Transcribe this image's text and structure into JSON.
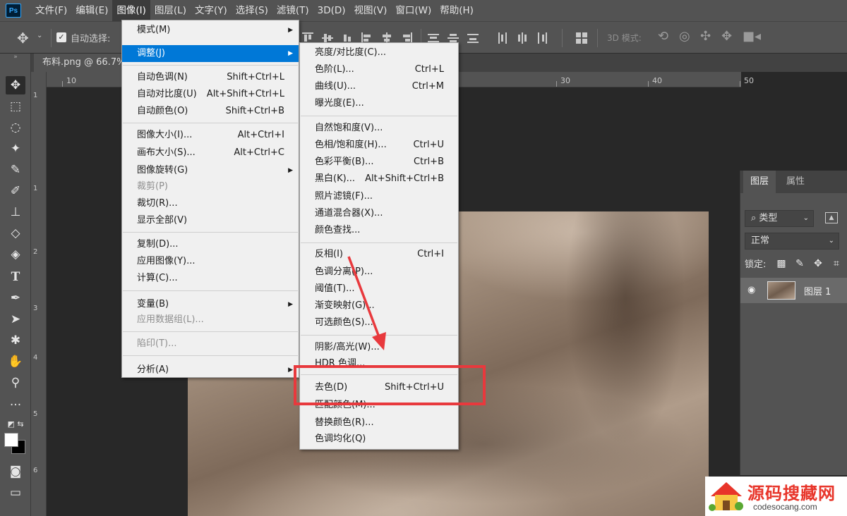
{
  "menubar": {
    "logo": "Ps",
    "items": [
      "文件(F)",
      "编辑(E)",
      "图像(I)",
      "图层(L)",
      "文字(Y)",
      "选择(S)",
      "滤镜(T)",
      "3D(D)",
      "视图(V)",
      "窗口(W)",
      "帮助(H)"
    ],
    "active_index": 2
  },
  "options_bar": {
    "auto_select_label": "自动选择:",
    "mode_3d_label": "3D 模式:"
  },
  "document": {
    "tab_title": "布料.png @ 66.7%"
  },
  "rulers": {
    "top": [
      "10",
      "30",
      "40",
      "50"
    ],
    "left": [
      "1",
      "1",
      "2",
      "3",
      "4",
      "5",
      "6"
    ]
  },
  "image_menu": {
    "items": [
      {
        "label": "模式(M)",
        "shortcut": "",
        "submenu": true
      },
      {
        "label": "调整(J)",
        "shortcut": "",
        "submenu": true,
        "highlighted": true
      },
      {
        "label": "自动色调(N)",
        "shortcut": "Shift+Ctrl+L"
      },
      {
        "label": "自动对比度(U)",
        "shortcut": "Alt+Shift+Ctrl+L"
      },
      {
        "label": "自动颜色(O)",
        "shortcut": "Shift+Ctrl+B"
      },
      {
        "label": "图像大小(I)...",
        "shortcut": "Alt+Ctrl+I"
      },
      {
        "label": "画布大小(S)...",
        "shortcut": "Alt+Ctrl+C"
      },
      {
        "label": "图像旋转(G)",
        "shortcut": "",
        "submenu": true
      },
      {
        "label": "裁剪(P)",
        "shortcut": "",
        "disabled": true
      },
      {
        "label": "裁切(R)...",
        "shortcut": ""
      },
      {
        "label": "显示全部(V)",
        "shortcut": ""
      },
      {
        "label": "复制(D)...",
        "shortcut": ""
      },
      {
        "label": "应用图像(Y)...",
        "shortcut": ""
      },
      {
        "label": "计算(C)...",
        "shortcut": ""
      },
      {
        "label": "变量(B)",
        "shortcut": "",
        "submenu": true
      },
      {
        "label": "应用数据组(L)...",
        "shortcut": "",
        "disabled": true
      },
      {
        "label": "陷印(T)...",
        "shortcut": "",
        "disabled": true
      },
      {
        "label": "分析(A)",
        "shortcut": "",
        "submenu": true
      }
    ]
  },
  "adjust_menu": {
    "items": [
      {
        "label": "亮度/对比度(C)...",
        "shortcut": ""
      },
      {
        "label": "色阶(L)...",
        "shortcut": "Ctrl+L"
      },
      {
        "label": "曲线(U)...",
        "shortcut": "Ctrl+M"
      },
      {
        "label": "曝光度(E)...",
        "shortcut": ""
      },
      {
        "label": "自然饱和度(V)...",
        "shortcut": ""
      },
      {
        "label": "色相/饱和度(H)...",
        "shortcut": "Ctrl+U"
      },
      {
        "label": "色彩平衡(B)...",
        "shortcut": "Ctrl+B"
      },
      {
        "label": "黑白(K)...",
        "shortcut": "Alt+Shift+Ctrl+B"
      },
      {
        "label": "照片滤镜(F)...",
        "shortcut": ""
      },
      {
        "label": "通道混合器(X)...",
        "shortcut": ""
      },
      {
        "label": "颜色查找...",
        "shortcut": ""
      },
      {
        "label": "反相(I)",
        "shortcut": "Ctrl+I"
      },
      {
        "label": "色调分离(P)...",
        "shortcut": ""
      },
      {
        "label": "阈值(T)...",
        "shortcut": ""
      },
      {
        "label": "渐变映射(G)...",
        "shortcut": ""
      },
      {
        "label": "可选颜色(S)...",
        "shortcut": ""
      },
      {
        "label": "阴影/高光(W)...",
        "shortcut": ""
      },
      {
        "label": "HDR 色调...",
        "shortcut": ""
      },
      {
        "label": "去色(D)",
        "shortcut": "Shift+Ctrl+U"
      },
      {
        "label": "匹配颜色(M)...",
        "shortcut": ""
      },
      {
        "label": "替换颜色(R)...",
        "shortcut": ""
      },
      {
        "label": "色调均化(Q)",
        "shortcut": ""
      }
    ]
  },
  "layers_panel": {
    "tabs": [
      "图层",
      "属性"
    ],
    "filter_type": "类型",
    "blend_mode": "正常",
    "lock_label": "锁定:",
    "layer_name": "图层 1"
  },
  "watermark": {
    "title": "源码搜藏网",
    "url": "codesocang.com"
  },
  "colors": {
    "menu_highlight": "#0078d7",
    "annotation_red": "#e8393d"
  }
}
